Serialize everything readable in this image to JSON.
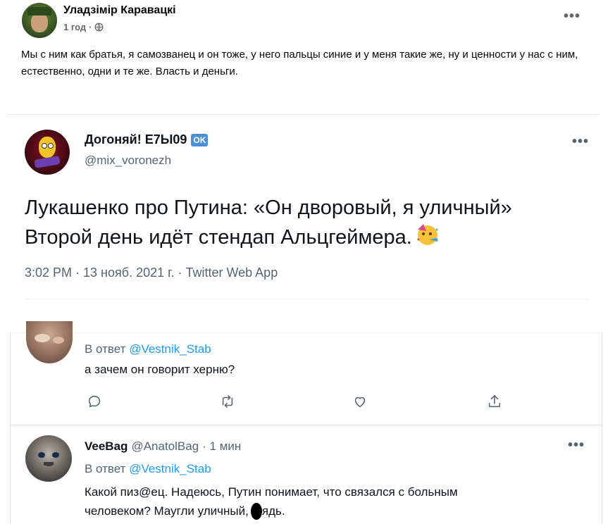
{
  "fb_post": {
    "author": "Уладзімір Каравацкі",
    "time": "1 год",
    "separator": "·",
    "text": "Мы с ним как братья, я самозванец и он тоже, у него пальцы синие и у меня такие же, ну и ценности у нас с ним, естественно, одни и те же. Власть и деньги."
  },
  "tweet": {
    "name": "Догоняй! Е7Ы09",
    "badge": "OK",
    "handle": "@mix_voronezh",
    "text_line1": "Лукашенко про Путина: «Он дворовый, я уличный»",
    "text_line2": "Второй день идёт стендап Альцгеймера.",
    "meta": "3:02 PM · 13 нояб. 2021 г. · Twitter Web App"
  },
  "reply1": {
    "reply_prefix": "В ответ",
    "reply_to": "@Vestnik_Stab",
    "text": "а зачем он говорит херню?"
  },
  "reply2": {
    "name": "VeeBag",
    "handle": "@AnatolBag",
    "time": "· 1 мин",
    "reply_prefix": "В ответ",
    "reply_to": "@Vestnik_Stab",
    "text_line1": "Какой пиз@ец. Надеюсь, Путин понимает, что связался с больным",
    "text_line2_a": "человеком? Маугли уличный,",
    "text_line2_b": "ядь."
  },
  "colors": {
    "twitter_blue": "#1d9bf0",
    "fb_muted": "#65676b",
    "tw_muted": "#536471",
    "badge_bg": "#4a8fd8"
  },
  "icons": [
    "globe-icon",
    "reply-icon",
    "retweet-icon",
    "like-icon",
    "share-icon",
    "more-icon"
  ]
}
